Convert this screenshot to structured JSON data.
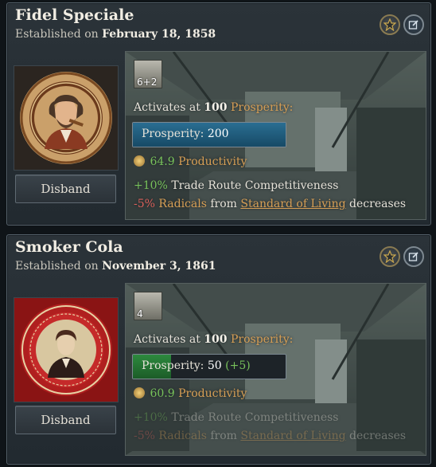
{
  "companies": [
    {
      "name": "Fidel Speciale",
      "established_prefix": "Established on",
      "established_date": "February 18, 1858",
      "disband_label": "Disband",
      "tier": "6+2",
      "activates_prefix": "Activates at",
      "activates_value": "100",
      "activates_suffix": "Prosperity:",
      "prosperity_label": "Prosperity:",
      "prosperity_value": "200",
      "prosperity_delta": "",
      "prosperity_fraction": 1.0,
      "productivity_value": "64.9",
      "productivity_label": "Productivity",
      "mod1_value": "+10%",
      "mod1_text": "Trade Route Competitiveness",
      "mod2_value": "-5%",
      "mod2_label": "Radicals",
      "mod2_from": "from",
      "mod2_link": "Standard of Living",
      "mod2_suffix": "decreases",
      "bar_color": "#2a6e92"
    },
    {
      "name": "Smoker Cola",
      "established_prefix": "Established on",
      "established_date": "November 3, 1861",
      "disband_label": "Disband",
      "tier": "4",
      "activates_prefix": "Activates at",
      "activates_value": "100",
      "activates_suffix": "Prosperity:",
      "prosperity_label": "Prosperity:",
      "prosperity_value": "50",
      "prosperity_delta": "(+5)",
      "prosperity_fraction": 0.25,
      "productivity_value": "60.9",
      "productivity_label": "Productivity",
      "mod1_value": "+10%",
      "mod1_text": "Trade Route Competitiveness",
      "mod2_value": "-5%",
      "mod2_label": "Radicals",
      "mod2_from": "from",
      "mod2_link": "Standard of Living",
      "mod2_suffix": "decreases",
      "bar_color": "#2d8a3e"
    }
  ]
}
